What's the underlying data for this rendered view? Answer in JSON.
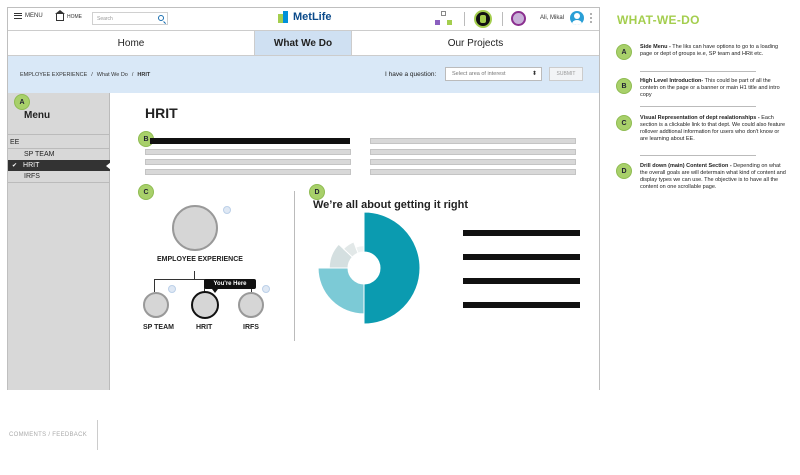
{
  "header": {
    "menu_label": "MENU",
    "home_label": "HOME",
    "search_placeholder": "Search",
    "brand": "MetLife",
    "user_name": "Ali, Mikal"
  },
  "nav": {
    "tabs": [
      {
        "label": "Home",
        "active": false
      },
      {
        "label": "What We Do",
        "active": true
      },
      {
        "label": "Our Projects",
        "active": false
      }
    ]
  },
  "breadcrumb": {
    "items": [
      "EMPLOYEE EXPERIENCE",
      "What We Do",
      "HRIT"
    ],
    "separator": "/"
  },
  "question": {
    "label": "I have a question:",
    "select_placeholder": "Select area of interest",
    "submit_label": "SUBMIT"
  },
  "sidebar": {
    "title": "Menu",
    "group": "EE",
    "items": [
      {
        "label": "SP TEAM",
        "active": false
      },
      {
        "label": "HRIT",
        "active": true
      },
      {
        "label": "IRFS",
        "active": false
      }
    ],
    "check": "✔"
  },
  "main": {
    "title": "HRIT",
    "org": {
      "parent": "EMPLOYEE EXPERIENCE",
      "children": [
        "SP TEAM",
        "HRIT",
        "IRFS"
      ],
      "tooltip": "You're Here"
    },
    "chart_title": "We’re all about getting it right"
  },
  "markers": [
    "A",
    "B",
    "C",
    "D"
  ],
  "chart_data": {
    "type": "pie",
    "title": "We’re all about getting it right",
    "values": [
      50,
      25,
      12,
      7,
      6
    ],
    "colors": [
      "#0b9bb0",
      "#7ccad6",
      "#d4dfe0",
      "#e2e8e8",
      "#eef2f2"
    ],
    "radii": [
      1.0,
      0.82,
      0.62,
      0.5,
      0.4
    ]
  },
  "right_panel": {
    "title": "WHAT-WE-DO",
    "notes": [
      {
        "marker": "A",
        "heading": "Side Menu -",
        "text": " The liks can have options to go to a loading page or dept of groups ie.e, SP team and HRit etc."
      },
      {
        "marker": "B",
        "heading": "High Level Introduction-",
        "text": " This could be part of all the contetn on the page or a banner or main H1 title and intro copy"
      },
      {
        "marker": "C",
        "heading": "Visual Representation of dept realationships -",
        "text": " Each section is a clickable link to that dept.  We could also feature rollover addtional information for users who don't know or are learning about EE."
      },
      {
        "marker": "D",
        "heading": "Drill down (main) Content Section -",
        "text": " Depending on what the overall goals are will determain what kind of content and display types we can use.  The objective is to have all the content on one scrollable page."
      }
    ]
  },
  "footer": {
    "label": "COMMENTS / FEEDBACK"
  },
  "colors": {
    "accent_green": "#a4ce4e",
    "nav_active": "#cfe0f2",
    "crumb_bg": "#d9e8f7",
    "chart_teal": "#0b9bb0"
  }
}
